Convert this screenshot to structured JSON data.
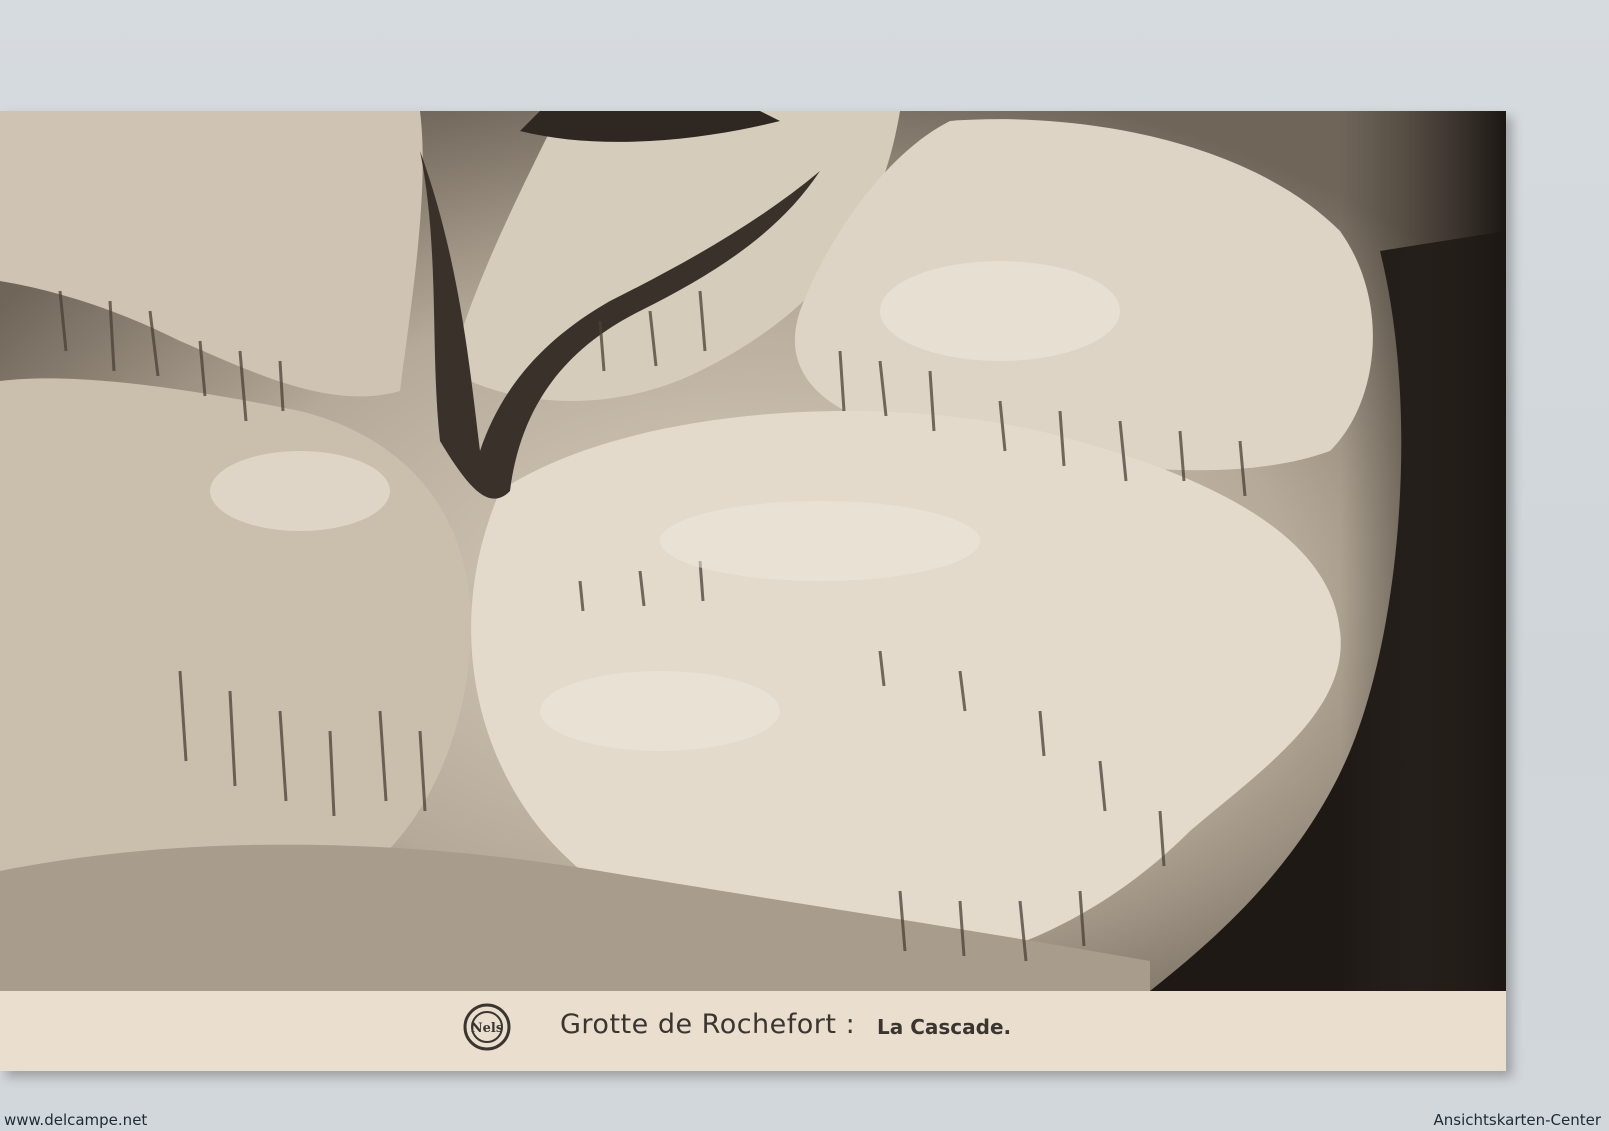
{
  "postcard": {
    "title": "Grotte de Rochefort :",
    "subtitle": "La Cascade.",
    "publisher_logo_text": "Nels"
  },
  "footer": {
    "left_watermark": "www.delcampe.net",
    "right_watermark": "Ansichtskarten-Center"
  },
  "colors": {
    "scan_background": "#d3d8dc",
    "card_paper": "#e8dccb",
    "caption_text": "#3b3530",
    "rock_highlight": "#e6ddcf",
    "cave_shadow": "#1f1a16"
  }
}
